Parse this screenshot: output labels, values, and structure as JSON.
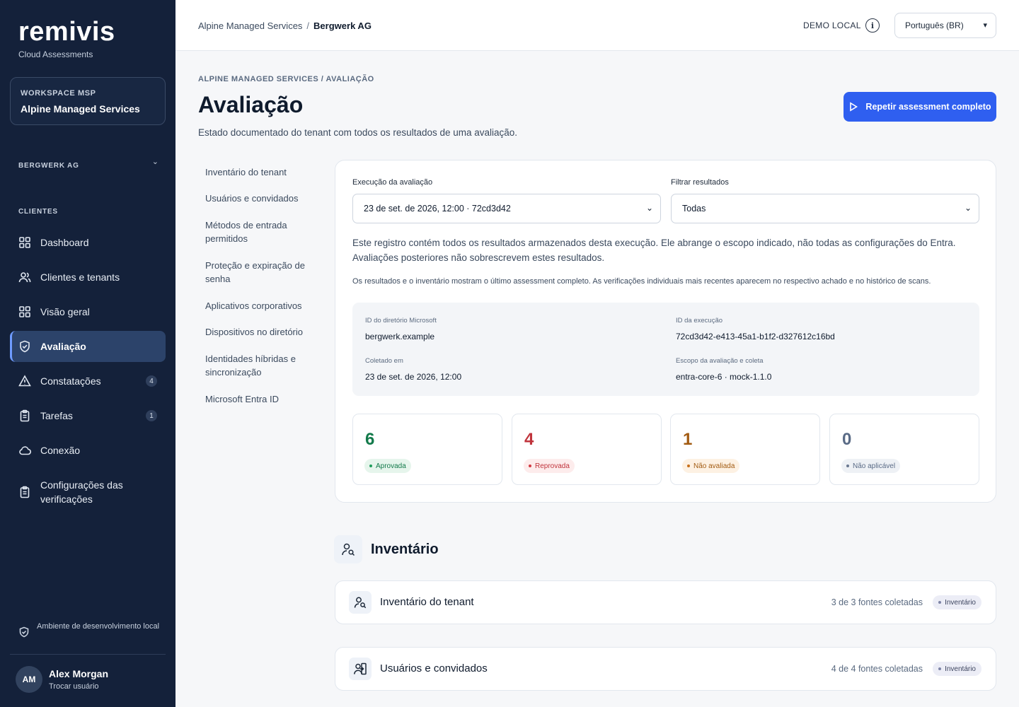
{
  "brand": {
    "name": "remivis",
    "subtitle": "Cloud Assessments"
  },
  "workspace": {
    "label": "WORKSPACE MSP",
    "name": "Alpine Managed Services"
  },
  "tenant_selector": {
    "label": "BERGWERK AG"
  },
  "sidebar": {
    "section_label": "CLIENTES",
    "items": [
      {
        "label": "Dashboard",
        "icon": "grid-icon",
        "badge": ""
      },
      {
        "label": "Clientes e tenants",
        "icon": "users-icon",
        "badge": ""
      },
      {
        "label": "Visão geral",
        "icon": "grid-icon",
        "badge": ""
      },
      {
        "label": "Avaliação",
        "icon": "shield-check-icon",
        "badge": "",
        "active": true
      },
      {
        "label": "Constatações",
        "icon": "warning-icon",
        "badge": "4"
      },
      {
        "label": "Tarefas",
        "icon": "clipboard-icon",
        "badge": "1"
      },
      {
        "label": "Conexão",
        "icon": "cloud-icon",
        "badge": ""
      },
      {
        "label": "Configurações das verificações",
        "icon": "clipboard-icon",
        "badge": ""
      }
    ],
    "environment_note": "Ambiente de desenvolvimento local",
    "user": {
      "initials": "AM",
      "name": "Alex Morgan",
      "action": "Trocar usuário"
    }
  },
  "topbar": {
    "breadcrumb": {
      "parent": "Alpine Managed Services",
      "separator": "/",
      "current": "Bergwerk AG"
    },
    "demo_label": "DEMO LOCAL",
    "info_glyph": "i",
    "language": {
      "selected": "Português (BR)"
    }
  },
  "page": {
    "crumb": "ALPINE MANAGED SERVICES / AVALIAÇÃO",
    "title": "Avaliação",
    "description": "Estado documentado do tenant com todos os resultados de uma avaliação.",
    "primary_button": "Repetir assessment completo"
  },
  "subnav": [
    "Inventário do tenant",
    "Usuários e convidados",
    "Métodos de entrada permitidos",
    "Proteção e expiração de senha",
    "Aplicativos corporativos",
    "Dispositivos no diretório",
    "Identidades híbridas e sincronização",
    "Microsoft Entra ID"
  ],
  "assessment": {
    "run_label": "Execução da avaliação",
    "run_value": "23 de set. de 2026, 12:00 · 72cd3d42",
    "filter_label": "Filtrar resultados",
    "filter_value": "Todas",
    "note_primary": "Este registro contém todos os resultados armazenados desta execução. Ele abrange o escopo indicado, não todas as configurações do Entra. Avaliações posteriores não sobrescrevem estes resultados.",
    "note_secondary": "Os resultados e o inventário mostram o último assessment completo. As verificações individuais mais recentes aparecem no respectivo achado e no histórico de scans.",
    "meta": {
      "directory_id_label": "ID do diretório Microsoft",
      "directory_id": "bergwerk.example",
      "run_id_label": "ID da execução",
      "run_id": "72cd3d42-e413-45a1-b1f2-d327612c16bd",
      "collected_label": "Coletado em",
      "collected": "23 de set. de 2026, 12:00",
      "scope_label": "Escopo da avaliação e coleta",
      "scope": "entra-core-6 · mock-1.1.0"
    },
    "stats": [
      {
        "value": "6",
        "label": "Aprovada",
        "color": "#137a4b",
        "pill_bg": "#e6f5ec",
        "dot": "#1f9d5c"
      },
      {
        "value": "4",
        "label": "Reprovada",
        "color": "#c0343c",
        "pill_bg": "#fdecec",
        "dot": "#d23b43"
      },
      {
        "value": "1",
        "label": "Não avaliada",
        "color": "#a25b12",
        "pill_bg": "#fdf1e3",
        "dot": "#c8701a"
      },
      {
        "value": "0",
        "label": "Não aplicável",
        "color": "#5a6b86",
        "pill_bg": "#eef1f5",
        "dot": "#6a7890"
      }
    ]
  },
  "inventory": {
    "title": "Inventário",
    "rows": [
      {
        "title": "Inventário do tenant",
        "meta": "3 de 3 fontes coletadas",
        "badge": "Inventário"
      },
      {
        "title": "Usuários e convidados",
        "meta": "4 de 4 fontes coletadas",
        "badge": "Inventário"
      }
    ]
  }
}
